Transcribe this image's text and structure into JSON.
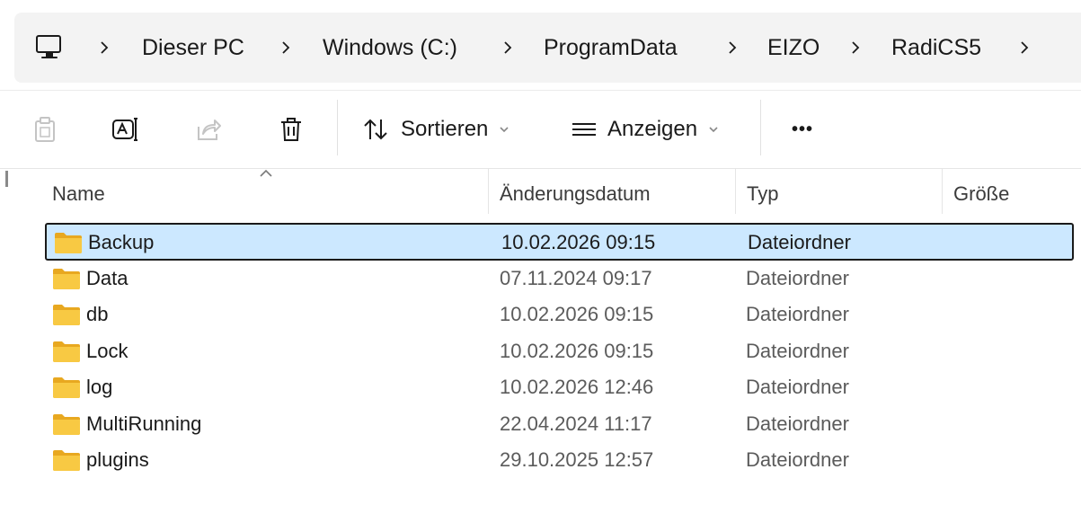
{
  "address_bar": {
    "root_icon": "computer-icon",
    "crumbs": [
      "Dieser PC",
      "Windows (C:)",
      "ProgramData",
      "EIZO",
      "RadiCS5"
    ]
  },
  "toolbar": {
    "copy_icon": "copy-icon",
    "rename_icon": "rename-icon",
    "share_icon": "share-icon",
    "delete_icon": "trash-icon",
    "sort_label": "Sortieren",
    "view_label": "Anzeigen",
    "more_label": "•••"
  },
  "columns": {
    "name": "Name",
    "modified": "Änderungsdatum",
    "type": "Typ",
    "size": "Größe"
  },
  "files": [
    {
      "name": "Backup",
      "modified": "10.02.2026 09:15",
      "type": "Dateiordner",
      "selected": true
    },
    {
      "name": "Data",
      "modified": "07.11.2024 09:17",
      "type": "Dateiordner",
      "selected": false
    },
    {
      "name": "db",
      "modified": "10.02.2026 09:15",
      "type": "Dateiordner",
      "selected": false
    },
    {
      "name": "Lock",
      "modified": "10.02.2026 09:15",
      "type": "Dateiordner",
      "selected": false
    },
    {
      "name": "log",
      "modified": "10.02.2026 12:46",
      "type": "Dateiordner",
      "selected": false
    },
    {
      "name": "MultiRunning",
      "modified": "22.04.2024 11:17",
      "type": "Dateiordner",
      "selected": false
    },
    {
      "name": "plugins",
      "modified": "29.10.2025 12:57",
      "type": "Dateiordner",
      "selected": false
    }
  ],
  "colors": {
    "selection_bg": "#cce8ff",
    "folder_yellow": "#f8c943",
    "address_bg": "#f3f3f3"
  }
}
